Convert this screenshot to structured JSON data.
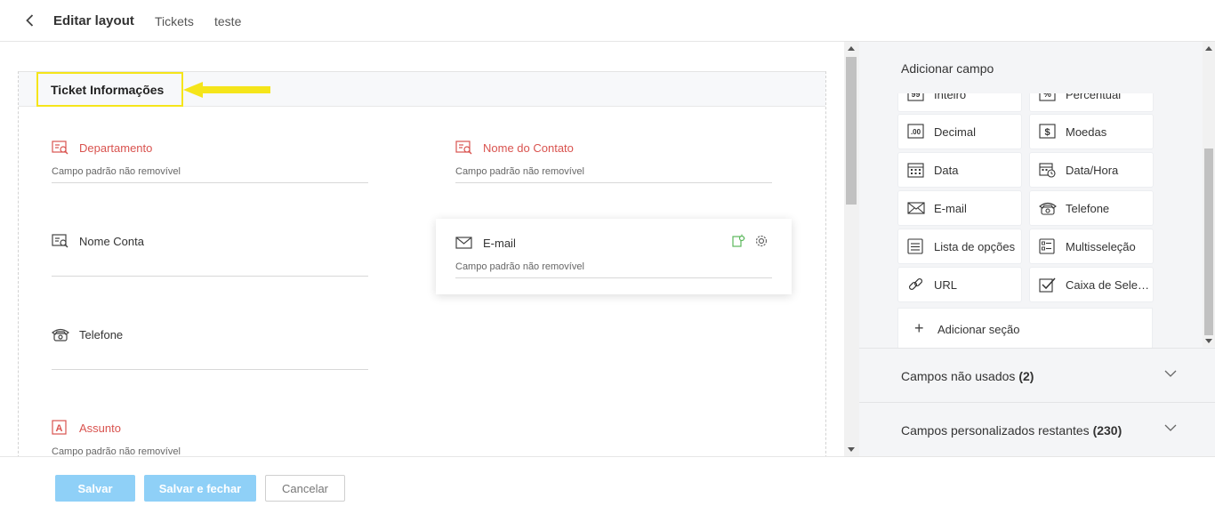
{
  "header": {
    "title": "Editar layout",
    "crumbs": [
      "Tickets",
      "teste"
    ]
  },
  "section": {
    "title": "Ticket Informações"
  },
  "fields": {
    "departamento": {
      "label": "Departamento",
      "sub": "Campo padrão não removível"
    },
    "nome_contato": {
      "label": "Nome do Contato",
      "sub": "Campo padrão não removível"
    },
    "nome_conta": {
      "label": "Nome Conta",
      "sub": ""
    },
    "email": {
      "label": "E-mail",
      "sub": "Campo padrão não removível"
    },
    "telefone": {
      "label": "Telefone",
      "sub": ""
    },
    "assunto": {
      "label": "Assunto",
      "sub": "Campo padrão não removível"
    }
  },
  "right_panel": {
    "title": "Adicionar campo",
    "tiles": {
      "inteiro": "Inteiro",
      "percentual": "Percentual",
      "decimal": "Decimal",
      "moedas": "Moedas",
      "data": "Data",
      "data_hora": "Data/Hora",
      "email": "E-mail",
      "telefone": "Telefone",
      "lista": "Lista de opções",
      "multi": "Multisseleção",
      "url": "URL",
      "caixa": "Caixa de Seleção"
    },
    "add_section": "Adicionar seção",
    "unused": {
      "label": "Campos não usados",
      "count": "(2)"
    },
    "remaining": {
      "label": "Campos personalizados restantes",
      "count": "(230)"
    }
  },
  "footer": {
    "save": "Salvar",
    "save_close": "Salvar e fechar",
    "cancel": "Cancelar"
  },
  "colors": {
    "highlight": "#f5e51a",
    "required_label": "#d9534f",
    "primary_button": "#8fd0f7"
  }
}
